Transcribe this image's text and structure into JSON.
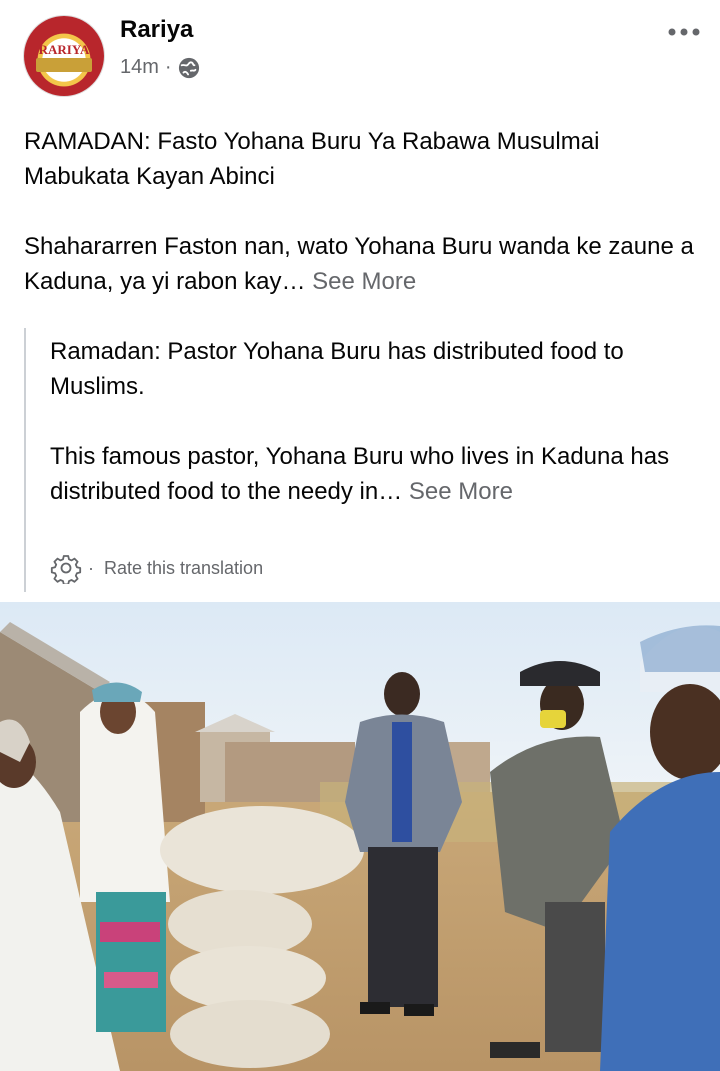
{
  "post": {
    "page_name": "Rariya",
    "logo_text": "RARIYA",
    "time": "14m",
    "separator": "·",
    "title": "RAMADAN: Fasto Yohana Buru Ya Rabawa Musulmai Mabukata Kayan Abinci",
    "body": "Shahararren Faston nan, wato Yohana Buru wanda ke zaune a Kaduna, ya yi rabon kay…",
    "see_more": "See More"
  },
  "translation": {
    "title": "Ramadan: Pastor Yohana Buru has distributed food to Muslims.",
    "body": "This famous pastor, Yohana Buru who lives in Kaduna has distributed food to the needy in…",
    "see_more": "See More",
    "rate_label": "Rate this translation",
    "separator": "·"
  },
  "icons": {
    "globe": "globe-icon",
    "more": "more-options-icon",
    "gear": "gear-icon"
  },
  "colors": {
    "secondary_text": "#65676b",
    "brand_red": "#b8262c",
    "brand_gold": "#f3c64a"
  }
}
